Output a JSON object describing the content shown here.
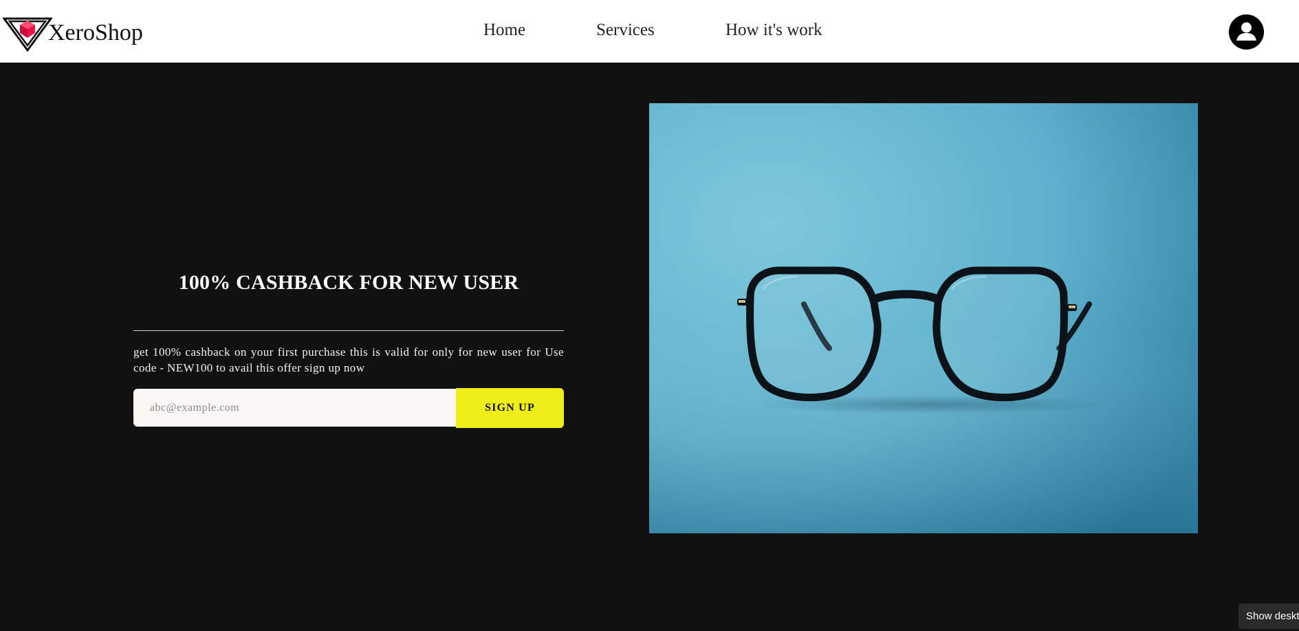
{
  "nav": {
    "brand": "XeroShop",
    "links": [
      "Home",
      "Services",
      "How it's work"
    ]
  },
  "hero": {
    "title": "100% CASHBACK FOR NEW USER",
    "description": "get 100% cashback on your first purchase this is valid for only for new user for Use code - NEW100 to avail this offer sign up now",
    "email_placeholder": "abc@example.com",
    "signup_label": "SIGN UP"
  },
  "tooltip": {
    "label": "Show desktop"
  },
  "colors": {
    "background": "#111111",
    "accent": "#f0ee18",
    "image_background": "#5fb0cc",
    "logo_red": "#e8154a"
  },
  "icons": [
    "xeroshop-logo-icon",
    "user-avatar-icon"
  ]
}
